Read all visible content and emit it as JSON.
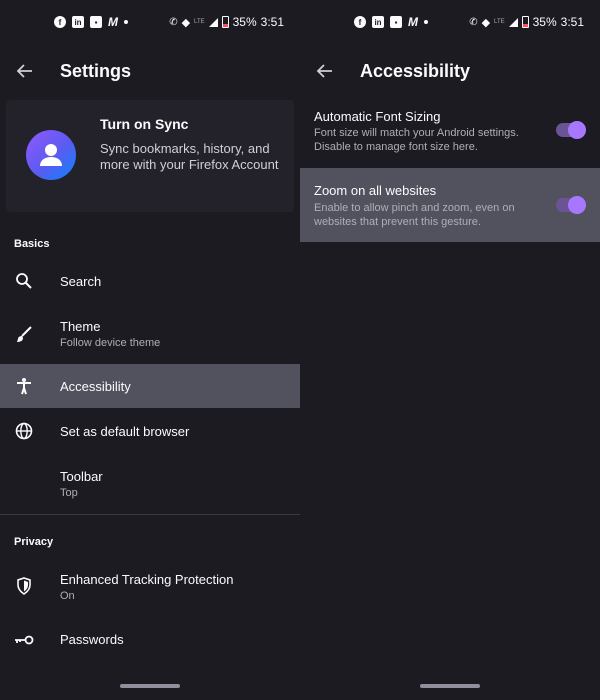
{
  "status_bar": {
    "battery_percent": "35%",
    "time": "3:51",
    "network": "LTE"
  },
  "settings": {
    "title": "Settings",
    "sync": {
      "title": "Turn on Sync",
      "description": "Sync bookmarks, history, and more with your Firefox Account"
    },
    "sections": {
      "basics": "Basics",
      "privacy": "Privacy"
    },
    "items": {
      "search": {
        "label": "Search",
        "icon": "search-icon"
      },
      "theme": {
        "label": "Theme",
        "sub": "Follow device theme",
        "icon": "brush-icon"
      },
      "accessibility": {
        "label": "Accessibility",
        "icon": "accessibility-icon"
      },
      "default_browser": {
        "label": "Set as default browser",
        "icon": "globe-icon"
      },
      "toolbar": {
        "label": "Toolbar",
        "sub": "Top"
      },
      "tracking": {
        "label": "Enhanced Tracking Protection",
        "sub": "On",
        "icon": "shield-icon"
      },
      "passwords": {
        "label": "Passwords",
        "icon": "key-icon"
      }
    }
  },
  "accessibility": {
    "title": "Accessibility",
    "prefs": {
      "font_sizing": {
        "title": "Automatic Font Sizing",
        "description": "Font size will match your Android settings. Disable to manage font size here.",
        "enabled": true
      },
      "zoom": {
        "title": "Zoom on all websites",
        "description": "Enable to allow pinch and zoom, even on websites that prevent this gesture.",
        "enabled": true
      }
    }
  },
  "colors": {
    "background": "#1c1b22",
    "highlight": "#52525e",
    "toggle_accent": "#a778ff"
  }
}
